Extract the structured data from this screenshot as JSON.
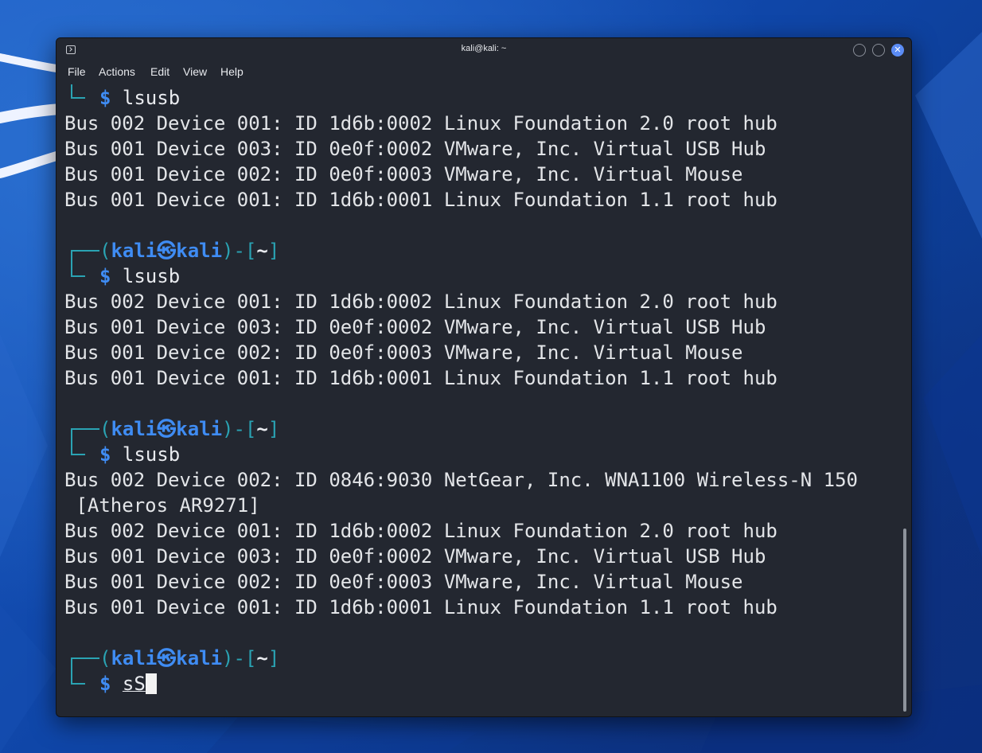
{
  "window": {
    "title": "kali@kali: ~"
  },
  "menu": {
    "file": "File",
    "actions": "Actions",
    "edit": "Edit",
    "view": "View",
    "help": "Help"
  },
  "prompt": {
    "user": "kali",
    "skull": "㉿",
    "host": "kali",
    "cwd": "~",
    "dollar": "$"
  },
  "terminal": {
    "block1": {
      "command": "lsusb",
      "output": [
        "Bus 002 Device 001: ID 1d6b:0002 Linux Foundation 2.0 root hub",
        "Bus 001 Device 003: ID 0e0f:0002 VMware, Inc. Virtual USB Hub",
        "Bus 001 Device 002: ID 0e0f:0003 VMware, Inc. Virtual Mouse",
        "Bus 001 Device 001: ID 1d6b:0001 Linux Foundation 1.1 root hub"
      ]
    },
    "block2": {
      "command": "lsusb",
      "output": [
        "Bus 002 Device 001: ID 1d6b:0002 Linux Foundation 2.0 root hub",
        "Bus 001 Device 003: ID 0e0f:0002 VMware, Inc. Virtual USB Hub",
        "Bus 001 Device 002: ID 0e0f:0003 VMware, Inc. Virtual Mouse",
        "Bus 001 Device 001: ID 1d6b:0001 Linux Foundation 1.1 root hub"
      ]
    },
    "block3": {
      "command": "lsusb",
      "output": [
        "Bus 002 Device 002: ID 0846:9030 NetGear, Inc. WNA1100 Wireless-N 150",
        " [Atheros AR9271]",
        "Bus 002 Device 001: ID 1d6b:0002 Linux Foundation 2.0 root hub",
        "Bus 001 Device 003: ID 0e0f:0002 VMware, Inc. Virtual USB Hub",
        "Bus 001 Device 002: ID 0e0f:0003 VMware, Inc. Virtual Mouse",
        "Bus 001 Device 001: ID 1d6b:0001 Linux Foundation 1.1 root hub"
      ]
    },
    "current_input": "sS"
  },
  "colors": {
    "terminal_bg": "#232730",
    "prompt_frame": "#2aa3b3",
    "prompt_user": "#3f8cf3",
    "text": "#e3e5e8",
    "close_button": "#5b8cf5",
    "desktop": "#1c5bc4"
  },
  "icons": {
    "title": "terminal-icon",
    "minimize": "minimize-icon",
    "maximize": "maximize-icon",
    "close": "close-icon"
  }
}
